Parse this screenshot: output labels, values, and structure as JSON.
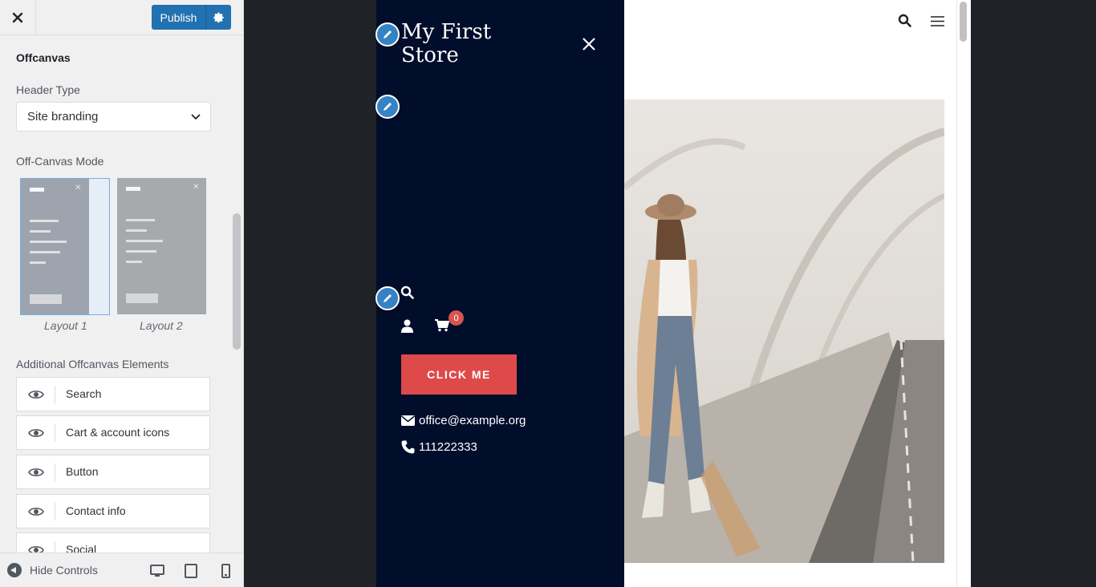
{
  "customizer": {
    "publish_label": "Publish",
    "section_title": "Offcanvas",
    "header_type_label": "Header Type",
    "header_type_value": "Site branding",
    "offcanvas_mode_label": "Off-Canvas Mode",
    "layouts": [
      {
        "label": "Layout 1",
        "selected": true
      },
      {
        "label": "Layout 2",
        "selected": false
      }
    ],
    "additional_label": "Additional Offcanvas Elements",
    "elements": [
      {
        "label": "Search",
        "icon": "eye-icon"
      },
      {
        "label": "Cart & account icons",
        "icon": "eye-icon"
      },
      {
        "label": "Button",
        "icon": "eye-icon"
      },
      {
        "label": "Contact info",
        "icon": "eye-icon"
      },
      {
        "label": "Social",
        "icon": "eye-icon"
      }
    ],
    "footer": {
      "hide_controls_label": "Hide Controls",
      "devices": [
        "desktop",
        "tablet",
        "mobile"
      ]
    }
  },
  "offcanvas": {
    "site_title": "My First Store",
    "cart_count": "0",
    "cta_label": "CLICK ME",
    "email": "office@example.org",
    "phone": "111222333"
  },
  "colors": {
    "accent": "#2271b1",
    "offcanvas_bg": "#000d2b",
    "cta_bg": "#de4a4a",
    "edit_pin": "#3582c4"
  }
}
